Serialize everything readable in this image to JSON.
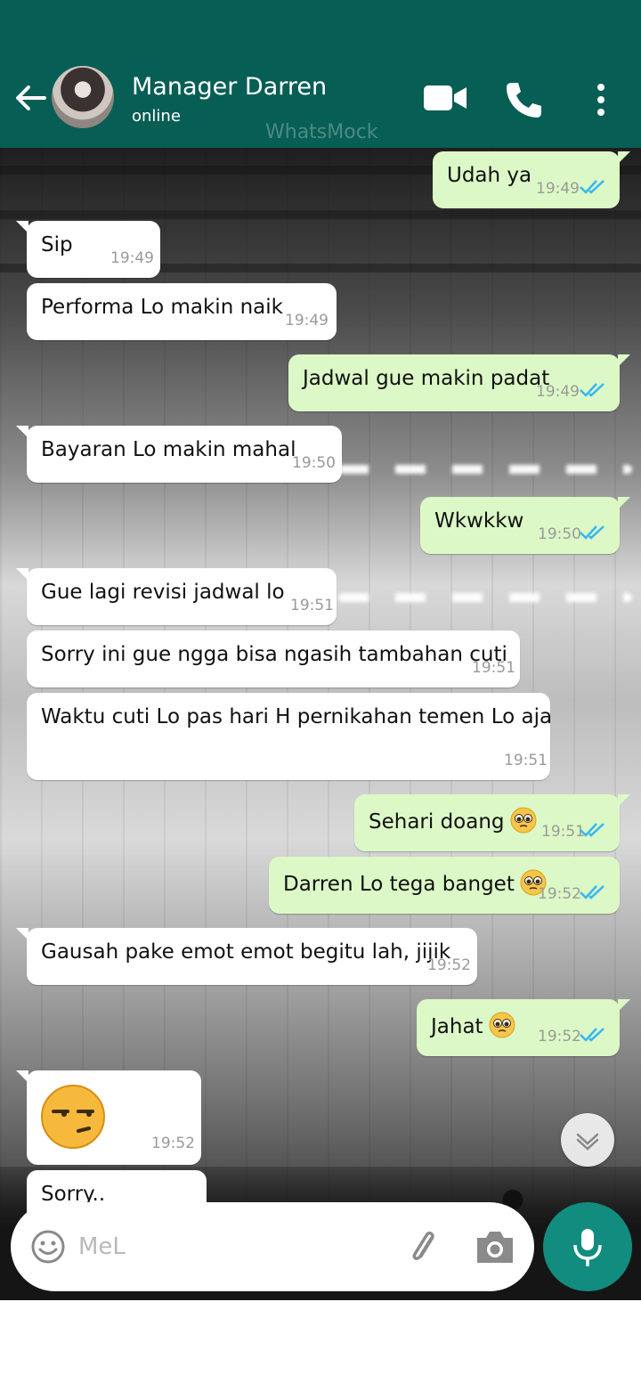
{
  "header": {
    "contact_name": "Manager Darren",
    "status": "online",
    "watermark": "WhatsMock",
    "icons": [
      "back-arrow-icon",
      "video-call-icon",
      "voice-call-icon",
      "more-vert-icon"
    ]
  },
  "messages": [
    {
      "dir": "out",
      "text": "Udah ya",
      "time": "19:49"
    },
    {
      "dir": "in",
      "text": "Sip",
      "time": "19:49"
    },
    {
      "dir": "in",
      "text": "Performa Lo makin naik",
      "time": "19:49"
    },
    {
      "dir": "out",
      "text": "Jadwal gue makin padat",
      "time": "19:49"
    },
    {
      "dir": "in",
      "text": "Bayaran Lo makin mahal",
      "time": "19:50"
    },
    {
      "dir": "out",
      "text": "Wkwkkw",
      "time": "19:50"
    },
    {
      "dir": "in",
      "text": "Gue lagi revisi jadwal lo",
      "time": "19:51"
    },
    {
      "dir": "in",
      "text": "Sorry ini gue ngga bisa ngasih tambahan cuti",
      "time": "19:51"
    },
    {
      "dir": "in",
      "text": "Waktu cuti Lo pas hari H pernikahan temen Lo aja",
      "time": "19:51"
    },
    {
      "dir": "out",
      "text": "Sehari doang",
      "emoji": "pleading-face",
      "time": "19:51"
    },
    {
      "dir": "out",
      "text": "Darren Lo tega banget",
      "emoji": "pleading-face",
      "time": "19:52"
    },
    {
      "dir": "in",
      "text": "Gausah pake emot emot begitu lah, jijik",
      "time": "19:52"
    },
    {
      "dir": "out",
      "text": "Jahat",
      "emoji": "pleading-face",
      "time": "19:52"
    },
    {
      "dir": "in",
      "emoji": "unamused-face",
      "time": "19:52"
    },
    {
      "dir": "in",
      "text": "Sorry..",
      "time": ""
    }
  ],
  "composer": {
    "placeholder": "MeL",
    "icons": [
      "emoji-icon",
      "attach-icon",
      "camera-icon",
      "mic-icon"
    ]
  },
  "colors": {
    "header": "#075e54",
    "outgoing_bubble": "#dcf8c6",
    "incoming_bubble": "#ffffff",
    "read_ticks": "#34b7f1",
    "mic_button": "#128c7e"
  }
}
